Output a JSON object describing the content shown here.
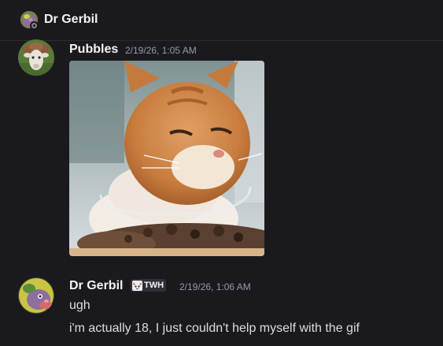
{
  "header": {
    "title": "Dr Gerbil",
    "avatar_icon": "gerbil-avatar-icon",
    "status": "offline"
  },
  "messages": [
    {
      "username": "Pubbles",
      "timestamp": "2/19/26, 1:05 AM",
      "avatar_icon": "goat-avatar-icon",
      "attachment": "cat-gif-image"
    },
    {
      "username": "Dr Gerbil",
      "tag": "TWH",
      "tag_icon": "cat-face-icon",
      "timestamp": "2/19/26, 1:06 AM",
      "avatar_icon": "gerbil-avatar-icon",
      "lines": [
        "ugh",
        "i'm actually 18, I just couldn't help myself with the gif"
      ]
    }
  ],
  "colors": {
    "background": "#1a1a1e",
    "username": "#f2f3f5",
    "timestamp": "#949ba4",
    "text": "#dbdee1"
  }
}
